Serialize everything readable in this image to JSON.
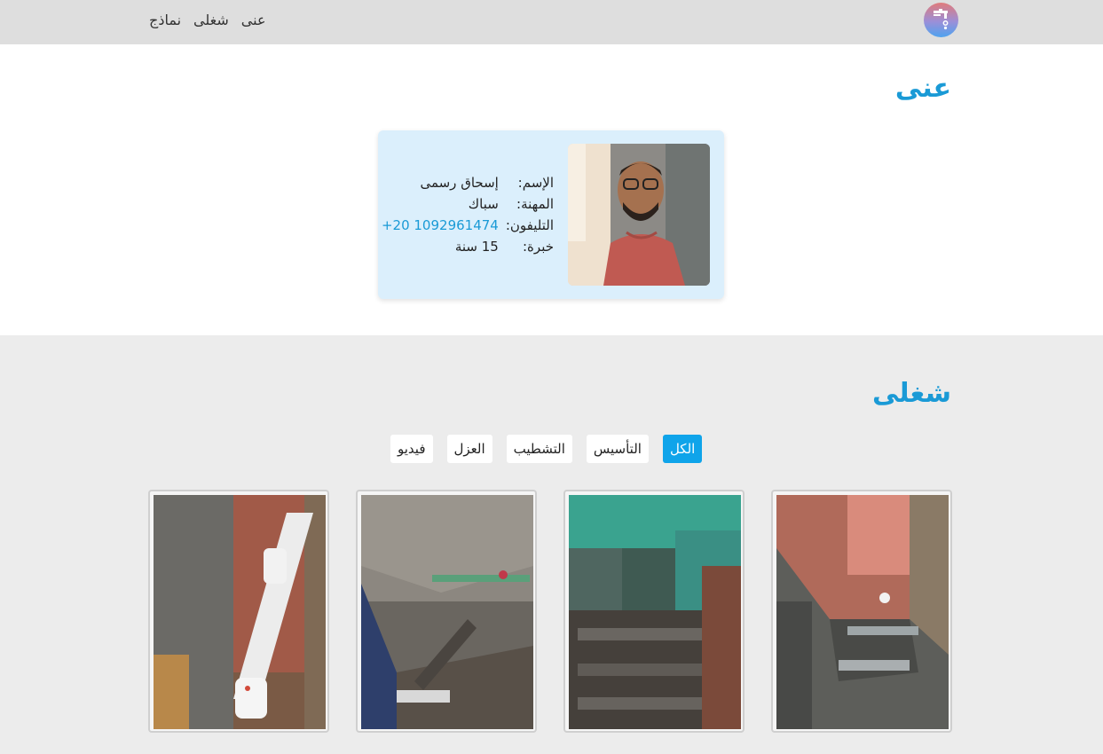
{
  "nav": {
    "logo_icon": "faucet-icon",
    "links": [
      "عنى",
      "شغلى",
      "نماذج"
    ]
  },
  "about": {
    "title": "عنى",
    "profile": {
      "name_label": "الإسم:",
      "name_value": "إسحاق رسمى",
      "job_label": "المهنة:",
      "job_value": "سباك",
      "phone_label": "التليفون:",
      "phone_value": "+20 1092961474",
      "experience_label": "خبرة:",
      "experience_value": "15 سنة"
    }
  },
  "work": {
    "title": "شغلى",
    "filters": [
      "الكل",
      "التأسيس",
      "التشطيب",
      "العزل",
      "فيديو"
    ],
    "active_filter": "الكل"
  },
  "colors": {
    "accent": "#1a9ad6",
    "active_filter": "#0fa4ea",
    "card_bg": "#dbeffc",
    "nav_bg": "#dedede",
    "section_bg": "#ececec"
  }
}
